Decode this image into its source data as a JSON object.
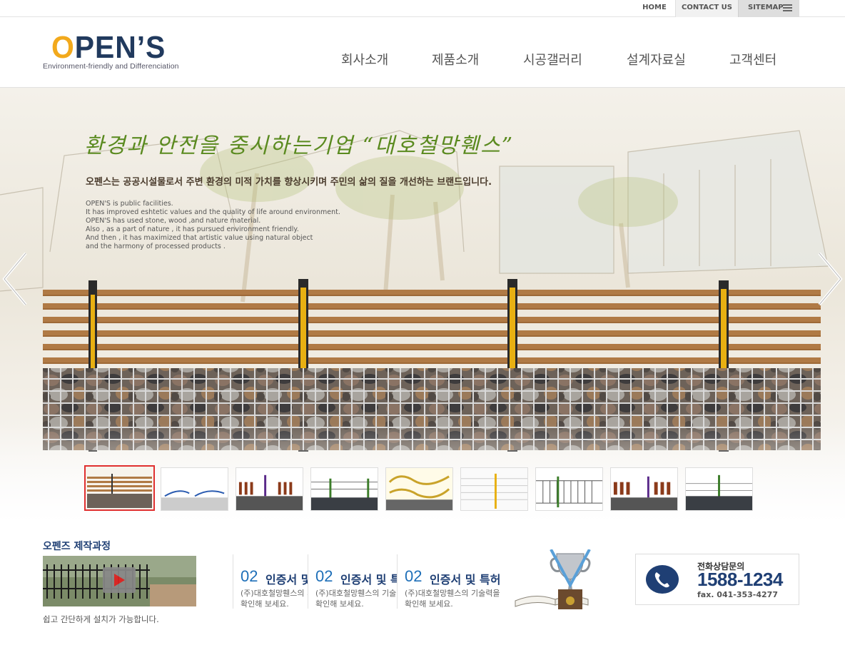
{
  "util_nav": {
    "home": "HOME",
    "contact": "CONTACT US",
    "sitemap": "SITEMAP"
  },
  "logo": {
    "main_o": "O",
    "main_rest": "PEN’S",
    "tagline": "Environment-friendly and Differenciation"
  },
  "gnb": [
    "회사소개",
    "제품소개",
    "시공갤러리",
    "설계자료실",
    "고객센터"
  ],
  "hero": {
    "title": "환경과 안전을 중시하는기업 “대호철망휀스”",
    "subtitle": "오펜스는 공공시설물로서 주변 환경의 미적 가치를 향상시키며 주민의 삶의 질을 개선하는 브랜드입니다.",
    "english": "OPEN'S is public facilities.\nIt has improved eshtetic values and the quality of life around environment.\nOPEN'S has used stone, wood ,and nature material.\nAlso , as a part of nature , it has pursued environment friendly.\nAnd then , it has maximized that artistic value using natural object\nand the harmony of processed products ."
  },
  "process": {
    "title": "오펜즈 제작과정",
    "description": "쉽고 간단하게 설치가 가능합니다."
  },
  "certs": [
    {
      "num": "02",
      "title": "인증서 및 특허",
      "line1": "(주)대호철망휀스의 기술력을",
      "line2": "확인해 보세요."
    },
    {
      "num": "02",
      "title": "인증서 및 특허",
      "line1": "(주)대호철망휀스의 기술력을",
      "line2": "확인해 보세요."
    },
    {
      "num": "02",
      "title": "인증서 및 특허",
      "line1": "(주)대호철망휀스의 기술력을",
      "line2": "확인해 보세요."
    }
  ],
  "contact": {
    "label": "전화상담문의",
    "number": "1588-1234",
    "fax": "fax. 041-353-4277"
  },
  "colors": {
    "brand_navy": "#1f3f74",
    "logo_orange": "#f2a91c",
    "cert_blue": "#1e6fb8",
    "thumb_active": "#e03030",
    "hero_title_green": "#5a8a1f"
  },
  "icons": [
    "hamburger-icon",
    "prev-arrow-icon",
    "next-arrow-icon",
    "play-icon",
    "phone-icon",
    "trophy-icon"
  ]
}
